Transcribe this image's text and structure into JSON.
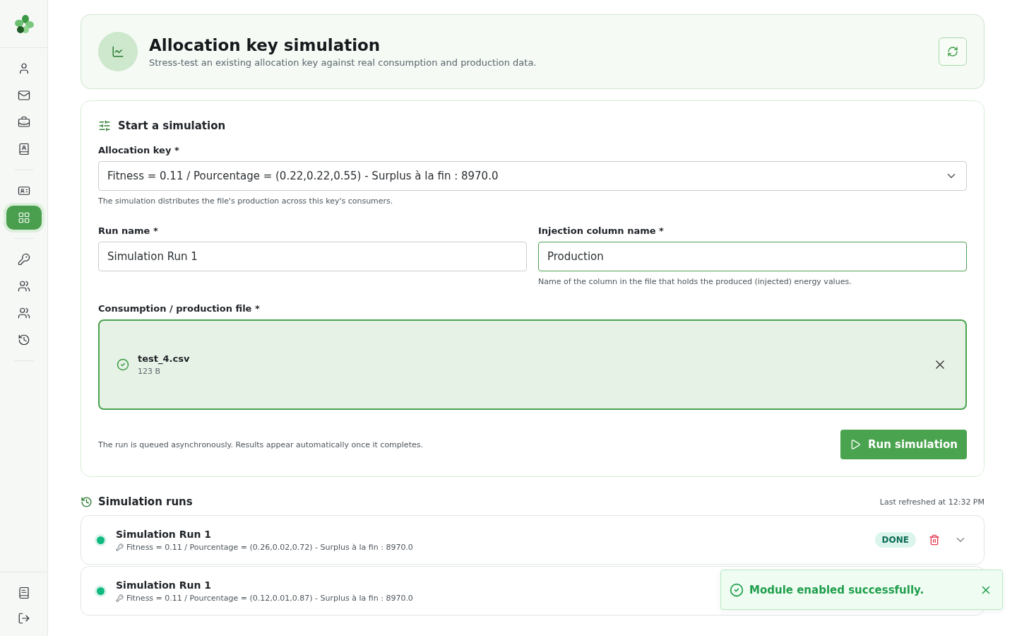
{
  "sidebar": {
    "groups": [
      [
        {
          "kind": "user",
          "selected": false
        },
        {
          "kind": "mail",
          "selected": false
        },
        {
          "kind": "briefcase",
          "selected": false
        },
        {
          "kind": "contacts",
          "selected": false
        }
      ],
      [
        {
          "kind": "idcard",
          "selected": false
        },
        {
          "kind": "grid",
          "selected": true
        }
      ],
      [
        {
          "kind": "key",
          "selected": false
        },
        {
          "kind": "users",
          "selected": false
        },
        {
          "kind": "users",
          "selected": false
        },
        {
          "kind": "history",
          "selected": false
        }
      ]
    ],
    "bottom": [
      {
        "kind": "book"
      },
      {
        "kind": "logout"
      }
    ]
  },
  "header": {
    "title": "Allocation key simulation",
    "subtitle": "Stress-test an existing allocation key against real consumption and production data."
  },
  "form": {
    "title": "Start a simulation",
    "allocation_key": {
      "label": "Allocation key *",
      "value": "Fitness = 0.11 / Pourcentage = (0.22,0.22,0.55) - Surplus à la fin : 8970.0",
      "help": "The simulation distributes the file's production across this key's consumers."
    },
    "run_name": {
      "label": "Run name *",
      "value": "Simulation Run 1",
      "focused": false
    },
    "injection_column": {
      "label": "Injection column name *",
      "value": "Production",
      "focused": true,
      "help": "Name of the column in the file that holds the produced (injected) energy values."
    },
    "file": {
      "label": "Consumption / production file *",
      "name": "test_4.csv",
      "size": "123 B"
    },
    "note": "The run is queued asynchronously. Results appear automatically once it completes.",
    "submit": "Run simulation"
  },
  "runs": {
    "title": "Simulation runs",
    "refreshed": "Last refreshed at 12:32 PM",
    "items": [
      {
        "name": "Simulation Run 1",
        "key": "Fitness = 0.11 / Pourcentage = (0.26,0.02,0.72) - Surplus à la fin : 8970.0",
        "status": "DONE",
        "color": "#10b981"
      },
      {
        "name": "Simulation Run 1",
        "key": "Fitness = 0.11 / Pourcentage = (0.12,0.01,0.87) - Surplus à la fin : 8970.0",
        "color": "#10b981"
      }
    ]
  },
  "toast": {
    "message": "Module enabled successfully."
  }
}
